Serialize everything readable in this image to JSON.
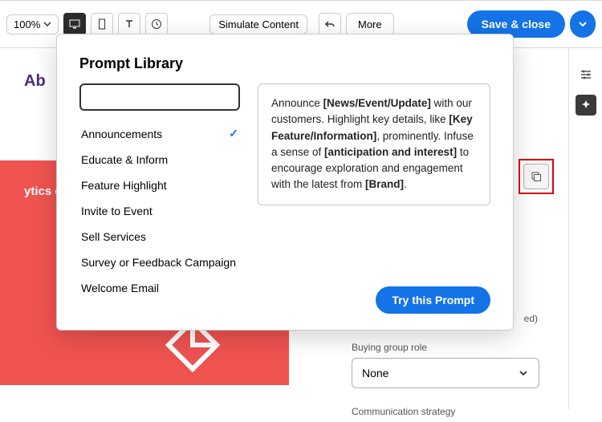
{
  "topbar": {
    "zoom_label": "100%",
    "simulate_label": "Simulate Content",
    "more_label": "More",
    "save_label": "Save & close"
  },
  "background": {
    "heading_fragment": "Ab",
    "red_text_fragment": "ytics ca"
  },
  "modal": {
    "title": "Prompt Library",
    "search_placeholder": "",
    "items": [
      {
        "label": "Announcements",
        "selected": true
      },
      {
        "label": "Educate & Inform",
        "selected": false
      },
      {
        "label": "Feature Highlight",
        "selected": false
      },
      {
        "label": "Invite to Event",
        "selected": false
      },
      {
        "label": "Sell Services",
        "selected": false
      },
      {
        "label": "Survey or Feedback Campaign",
        "selected": false
      },
      {
        "label": "Welcome Email",
        "selected": false
      }
    ],
    "preview": {
      "parts": [
        "Announce ",
        "[News/Event/Update]",
        " with our customers. Highlight key details, like ",
        "[Key Feature/Information]",
        ", prominently. Infuse a sense of ",
        "[anticipation and interest]",
        " to encourage exploration and engagement with the latest from ",
        "[Brand]",
        "."
      ]
    },
    "try_label": "Try this Prompt"
  },
  "right_panel": {
    "trailing_text": "ed)",
    "buying_group_label": "Buying group role",
    "buying_group_value": "None",
    "comm_label": "Communication strategy"
  }
}
